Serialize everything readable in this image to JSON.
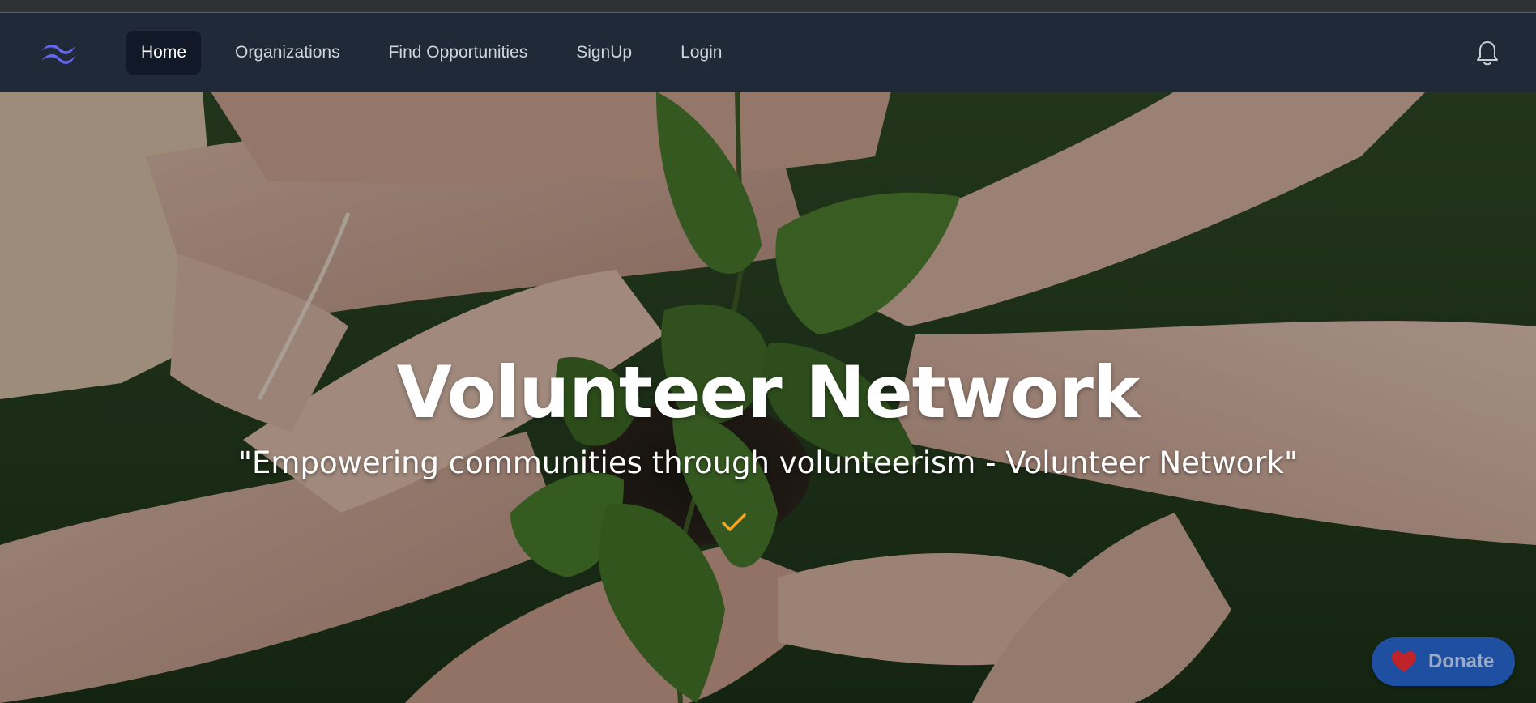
{
  "nav": {
    "logo_icon": "tailwind-wave-logo-icon",
    "items": [
      {
        "label": "Home",
        "active": true
      },
      {
        "label": "Organizations",
        "active": false
      },
      {
        "label": "Find Opportunities",
        "active": false
      },
      {
        "label": "SignUp",
        "active": false
      },
      {
        "label": "Login",
        "active": false
      }
    ],
    "notification_icon": "bell-icon"
  },
  "hero": {
    "title": "Volunteer Network",
    "tagline": "\"Empowering communities through volunteerism - Volunteer Network\"",
    "scroll_icon": "check-chevron-icon"
  },
  "donate": {
    "label": "Donate",
    "icon": "heart-icon"
  },
  "colors": {
    "nav_bg": "#1f2937",
    "active_bg": "#111827",
    "logo": "#6366f1",
    "accent_check": "#f5a623",
    "donate_bg": "#1e4fa0",
    "heart": "#c0242b"
  }
}
